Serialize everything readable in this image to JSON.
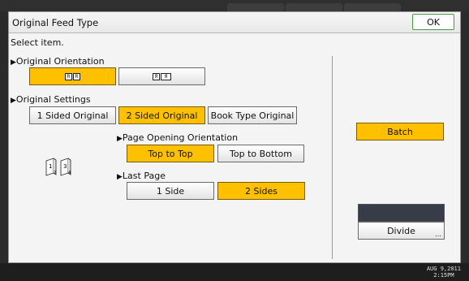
{
  "title": "Original Feed Type",
  "ok_label": "OK",
  "select_item": "Select item.",
  "orientation": {
    "label": "Original Orientation",
    "options": [
      {
        "id": "readable",
        "selected": true
      },
      {
        "id": "unreadable",
        "selected": false
      }
    ]
  },
  "settings": {
    "label": "Original Settings",
    "buttons": [
      "1 Sided Original",
      "2 Sided Original",
      "Book Type Original"
    ],
    "selected": "2 Sided Original"
  },
  "page_opening": {
    "label": "Page Opening Orientation",
    "buttons": [
      "Top to Top",
      "Top to Bottom"
    ],
    "selected": "Top to Top"
  },
  "last_page": {
    "label": "Last Page",
    "buttons": [
      "1 Side",
      "2 Sides"
    ],
    "selected": "2 Sides"
  },
  "batch_label": "Batch",
  "divide_label": "Divide",
  "status": {
    "date": "AUG   9,2011",
    "time": "2:15PM"
  },
  "colors": {
    "selected": "#ffc000",
    "ok_border": "#4a9a4a"
  },
  "page_icons": [
    {
      "front": "1",
      "back": "2"
    },
    {
      "front": "3",
      "back": "4"
    }
  ]
}
